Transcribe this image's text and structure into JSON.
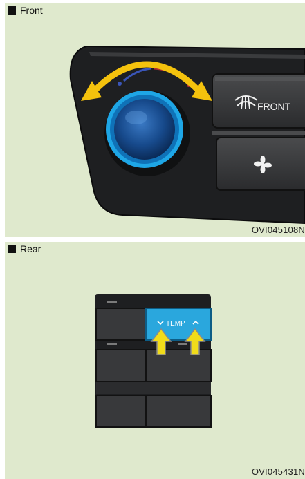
{
  "front": {
    "caption": "Front",
    "button_front_label": "FRONT",
    "figure_code": "OVI045108N"
  },
  "rear": {
    "caption": "Rear",
    "temp_label": "TEMP",
    "figure_code": "OVI045431N"
  },
  "colors": {
    "panel_bg": "#dfe9cd",
    "knob_ring": "#1ea6e6",
    "knob_center": "#1b4d8f",
    "arrow_yellow": "#f1dc1a",
    "temp_button": "#2aa7dd"
  }
}
